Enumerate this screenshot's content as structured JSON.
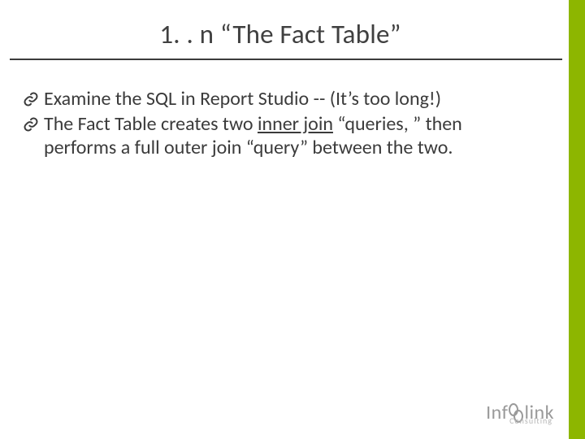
{
  "title": "1. . n “The Fact Table”",
  "bullets": [
    {
      "text": "Examine the SQL in Report Studio -- (It’s too long!)"
    },
    {
      "pre": "The Fact Table creates two ",
      "u": "inner join",
      "post": " “queries, ” then performs a full outer join “query” between the two."
    }
  ],
  "logo": {
    "part1": "Inf",
    "part2": "link",
    "sub": "Consulting"
  }
}
